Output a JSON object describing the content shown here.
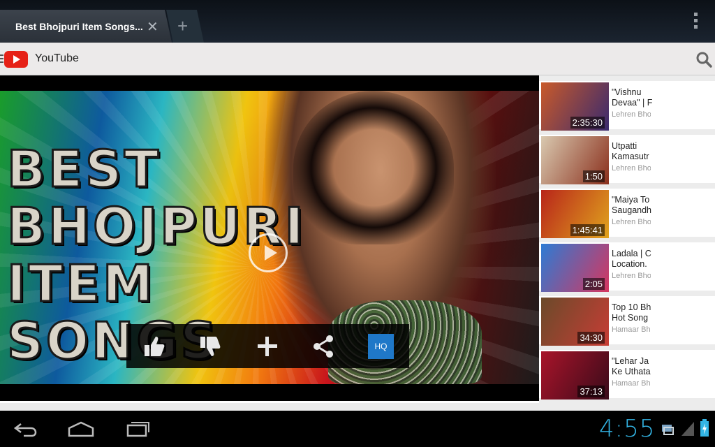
{
  "browser": {
    "tab_title": "Best Bhojpuri Item Songs...",
    "close_tab": "✕",
    "new_tab": "+"
  },
  "youtube": {
    "app_title": "YouTube"
  },
  "player": {
    "overlay_words": [
      "BEST",
      "BHOJPURI",
      "ITEM",
      "SONGS"
    ],
    "hq_label": "HQ",
    "progress": 0.0
  },
  "related": [
    {
      "title_lines": [
        "\"Vishnu",
        "Devaa\" | F"
      ],
      "channel": "Lehren Bho",
      "duration": "2:35:30",
      "thumb_colors": [
        "#c95a2a",
        "#3a2a6e"
      ]
    },
    {
      "title_lines": [
        "Utpatti",
        "Kamasutr"
      ],
      "channel": "Lehren Bho",
      "duration": "1:50",
      "thumb_colors": [
        "#d9c9b0",
        "#8a2f1c"
      ]
    },
    {
      "title_lines": [
        "\"Maiya To",
        "Saugandh"
      ],
      "channel": "Lehren Bho",
      "duration": "1:45:41",
      "thumb_colors": [
        "#b8251a",
        "#e0a31e"
      ]
    },
    {
      "title_lines": [
        "Ladala | C",
        "Location."
      ],
      "channel": "Lehren Bho",
      "duration": "2:05",
      "thumb_colors": [
        "#2d7bd4",
        "#d6365f"
      ]
    },
    {
      "title_lines": [
        "Top 10 Bh",
        "Hot Song"
      ],
      "channel": "Hamaar Bh",
      "duration": "34:30",
      "thumb_colors": [
        "#6b4a2a",
        "#c73d35"
      ]
    },
    {
      "title_lines": [
        "\"Lehar Ja",
        "Ke Uthata"
      ],
      "channel": "Hamaar Bh",
      "duration": "37:13",
      "thumb_colors": [
        "#a8142a",
        "#3a0b1a"
      ]
    }
  ],
  "status": {
    "clock": "4:55"
  }
}
